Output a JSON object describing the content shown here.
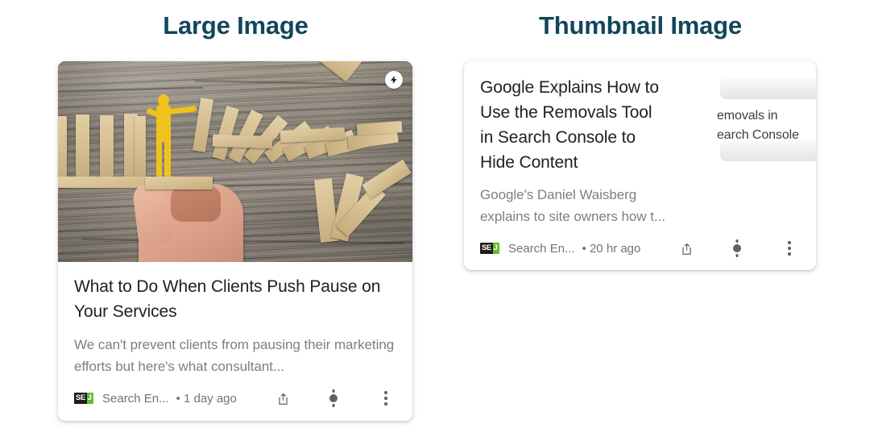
{
  "headings": {
    "left": "Large Image",
    "right": "Thumbnail Image",
    "color": "#13455c"
  },
  "cards": [
    {
      "id": "large-image-card",
      "layout": "large-image",
      "badge": {
        "name": "amp-badge",
        "glyph": "⚡"
      },
      "image_alt": "Yellow paper figure stopping a line of falling wooden dominoes on a rustic wood table, with a hand placing a block",
      "title": "What to Do When Clients Push Pause on Your Services",
      "snippet": "We can't prevent clients from pausing their marketing efforts but here's what consultant...",
      "source": {
        "logo_left": "SE",
        "logo_right": "J",
        "name": "Search En...",
        "logo_dark_color": "#1d1d1b",
        "logo_green_color": "#66bb2e"
      },
      "timestamp": "• 1 day ago",
      "actions": [
        {
          "name": "share-button",
          "label": "Share"
        },
        {
          "name": "follow-button",
          "label": "Follow"
        },
        {
          "name": "more-options-button",
          "label": "More options"
        }
      ]
    },
    {
      "id": "thumbnail-image-card",
      "layout": "thumbnail-image",
      "title": "Google Explains How to Use the Removals Tool in Search Console to Hide Content",
      "snippet": "Google's Daniel Waisberg explains to site owners how t...",
      "thumbnail_text_line1": "emovals in",
      "thumbnail_text_line2": "earch Console",
      "source": {
        "logo_left": "SE",
        "logo_right": "J",
        "name": "Search En...",
        "logo_dark_color": "#1d1d1b",
        "logo_green_color": "#66bb2e"
      },
      "timestamp": "• 20 hr ago",
      "actions": [
        {
          "name": "share-button",
          "label": "Share"
        },
        {
          "name": "follow-button",
          "label": "Follow"
        },
        {
          "name": "more-options-button",
          "label": "More options"
        }
      ]
    }
  ]
}
